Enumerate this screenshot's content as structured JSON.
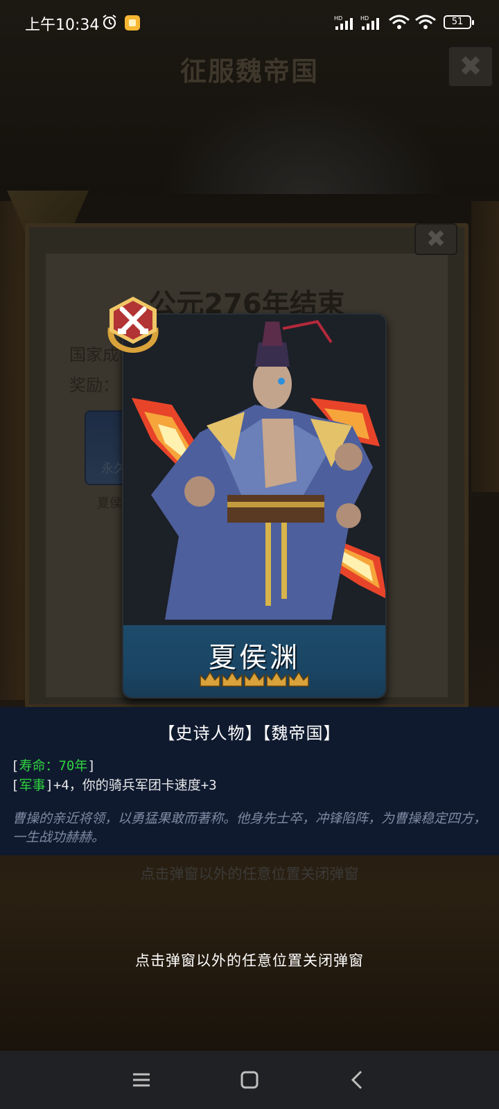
{
  "status_bar": {
    "time": "上午10:34",
    "battery": "51",
    "signal_label_1": "HD",
    "signal_label_2": "HD"
  },
  "background": {
    "title": "征服魏帝国",
    "dialog_title": "公元276年结束",
    "label_country": "国家成",
    "label_reward": "奖励：",
    "reward_card_tag": "永久",
    "reward_name": "夏侯渊",
    "hint": "点击弹窗以外的任意位置关闭弹窗"
  },
  "hero": {
    "name": "夏侯渊",
    "stars": 5,
    "badge_icon": "crossed-swords-icon"
  },
  "info": {
    "tags": "【史诗人物】【魏帝国】",
    "life_bracket_open": "[",
    "life_label": "寿命：70年",
    "life_bracket_close": "]",
    "military_bracket_open": "[",
    "military_label": "军事",
    "military_rest": "]+4，你的骑兵军团卡速度+3",
    "description": "曹操的亲近将领，以勇猛果敢而著称。他身先士卒，冲锋陷阵，为曹操稳定四方，一生战功赫赫。"
  },
  "hint": "点击弹窗以外的任意位置关闭弹窗",
  "colors": {
    "stat_green": "#2fd33f",
    "panel_bg": "#0f1a2f",
    "name_band": "#1e4b6b",
    "gold": "#d9a23a"
  },
  "nav": {
    "menu_icon": "menu-icon",
    "home_icon": "home-icon",
    "back_icon": "back-icon"
  }
}
